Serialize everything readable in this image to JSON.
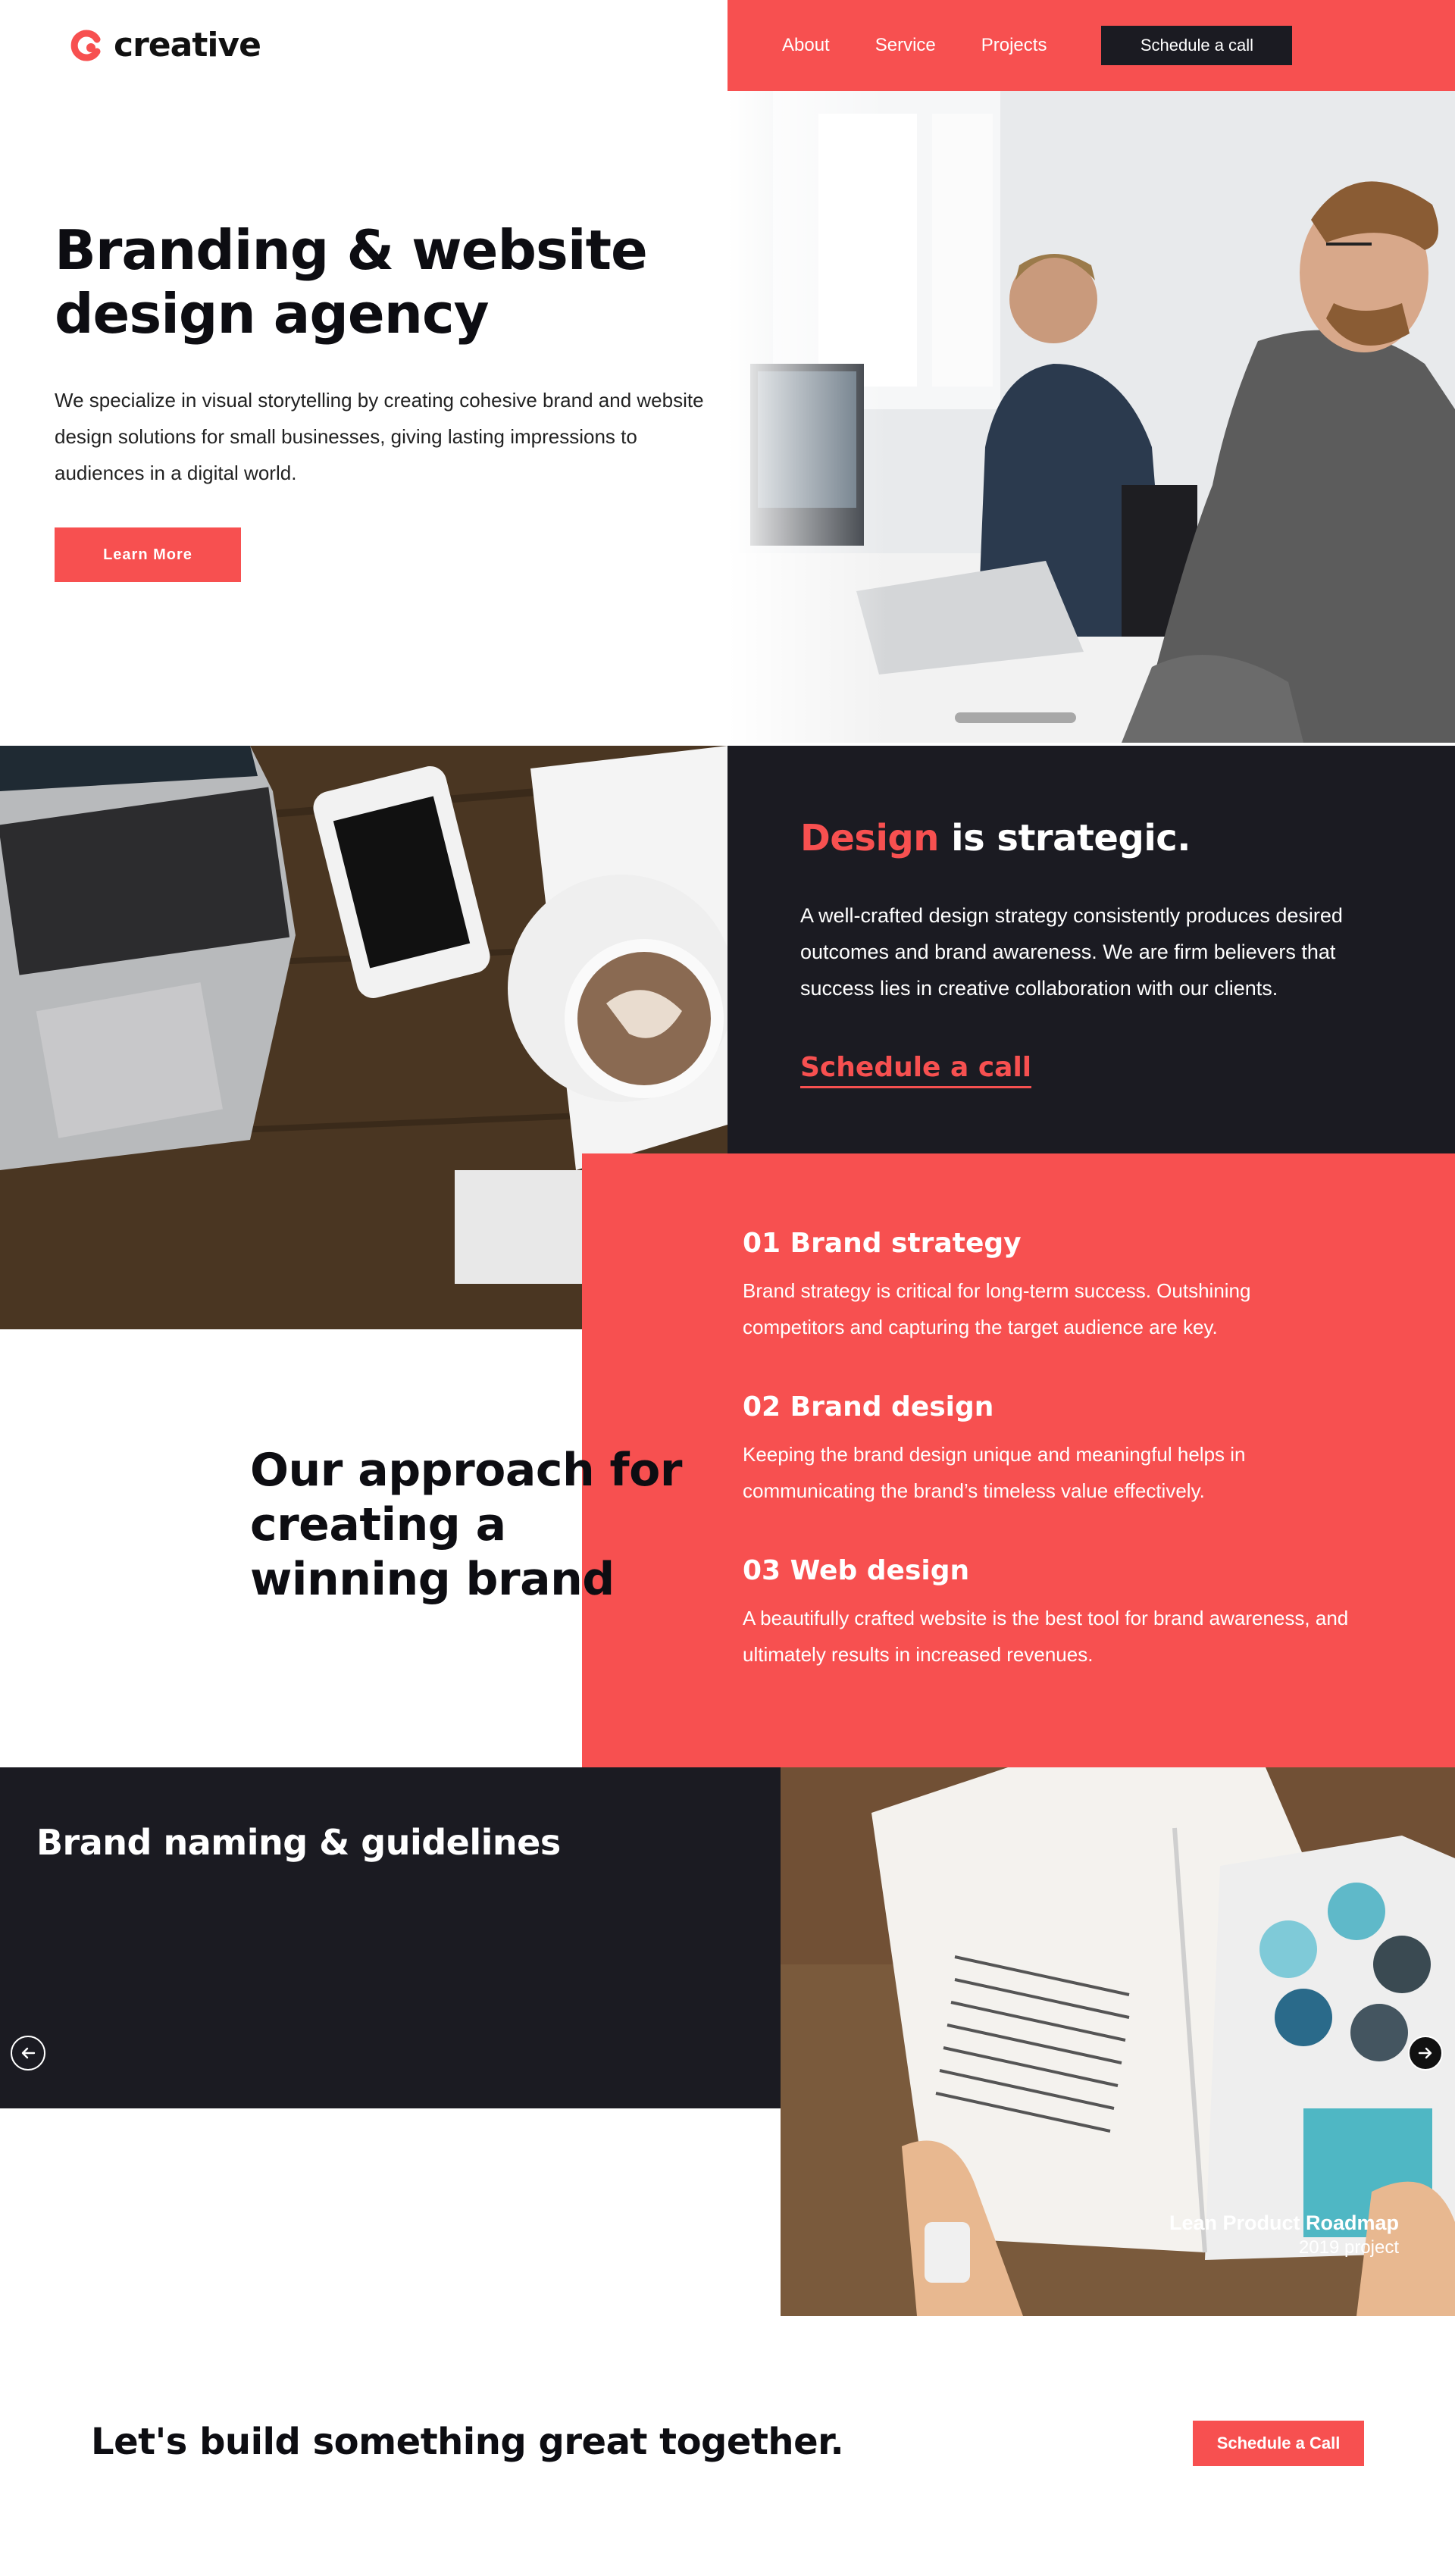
{
  "brand": {
    "name": "creative",
    "accent": "#f75050",
    "dark": "#1b1b22"
  },
  "nav": {
    "items": [
      {
        "label": "About"
      },
      {
        "label": "Service"
      },
      {
        "label": "Projects"
      }
    ],
    "cta": "Schedule a call"
  },
  "hero": {
    "title": "Branding & website design agency",
    "text": "We specialize in visual storytelling by creating cohesive brand and website design solutions for small businesses, giving lasting impressions to audiences in a digital world.",
    "button": "Learn More",
    "image": "two-designers-at-computers-photo"
  },
  "strategic": {
    "title_accent": "Design",
    "title_rest": " is strategic.",
    "text": "A well-crafted design strategy consistently produces desired outcomes and brand awareness. We are firm believers that success lies in creative collaboration with our clients.",
    "link": "Schedule a call",
    "image": "laptop-phone-coffee-desk-photo"
  },
  "approach": {
    "title": "Our approach for creating a winning brand",
    "steps": [
      {
        "title": "01 Brand strategy",
        "text": "Brand strategy is critical for long-term success. Outshining competitors and capturing the target audience are key."
      },
      {
        "title": "02 Brand design",
        "text": "Keeping the brand design unique and meaningful helps in communicating the brand’s timeless value effectively."
      },
      {
        "title": "03 Web design",
        "text": "A beautifully crafted website is the best tool for brand awareness, and ultimately results in increased revenues."
      }
    ]
  },
  "slider": {
    "title": "Brand naming & guidelines",
    "project_name": "Lean Product Roadmap",
    "project_year": "2019 project",
    "image": "open-book-lean-product-photo"
  },
  "cta": {
    "text": "Let's build something great together.",
    "button": "Schedule a Call"
  }
}
